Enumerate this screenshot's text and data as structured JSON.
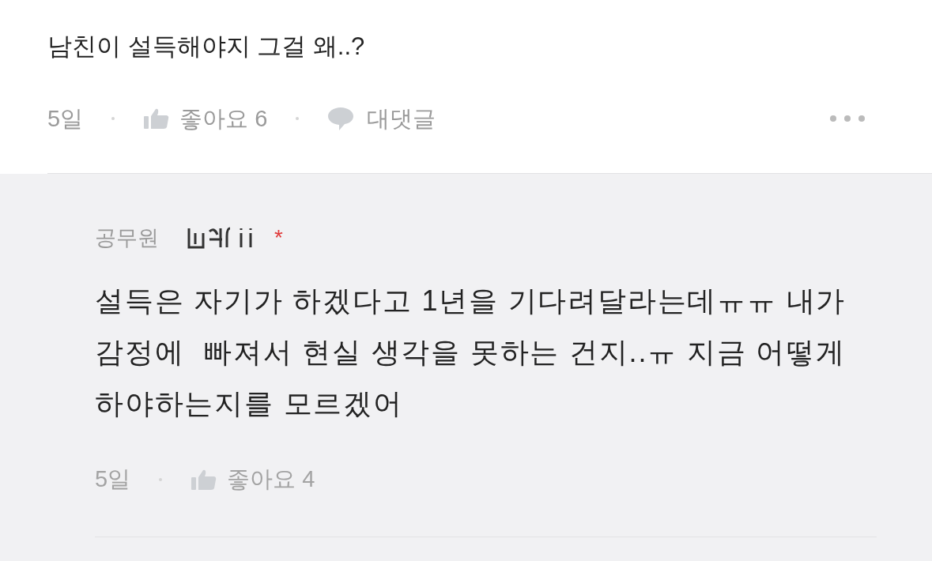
{
  "comment": {
    "text": "남친이 설득해야지 그걸 왜..?",
    "time": "5일",
    "likes": "좋아요 6",
    "reply_action": "대댓글"
  },
  "reply": {
    "author": "공무원",
    "badge": "*",
    "text": "설득은 자기가 하겠다고 1년을 기다려달라는데ㅠㅠ 내가 감정에  빠져서 현실 생각을 못하는 건지..ㅠ 지금 어떻게 하야하는지를 모르겠어",
    "time": "5일",
    "likes": "좋아요 4"
  }
}
